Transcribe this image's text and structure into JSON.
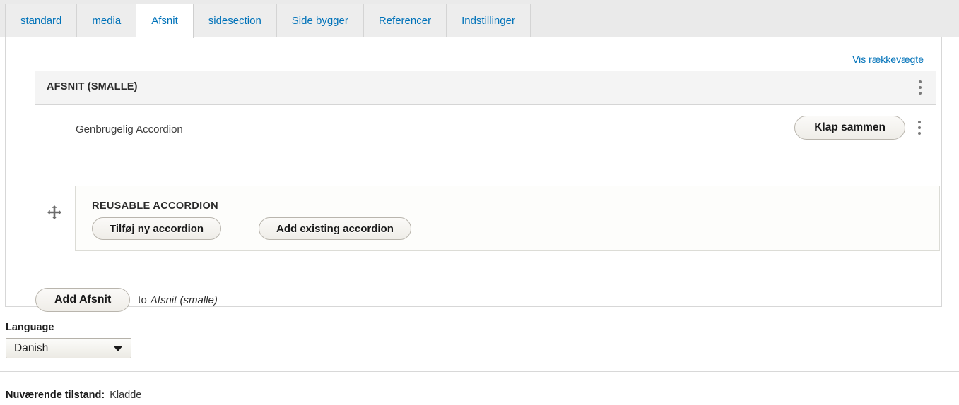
{
  "tabs": [
    {
      "label": "standard",
      "active": false
    },
    {
      "label": "media",
      "active": false
    },
    {
      "label": "Afsnit",
      "active": true
    },
    {
      "label": "sidesection",
      "active": false
    },
    {
      "label": "Side bygger",
      "active": false
    },
    {
      "label": "Referencer",
      "active": false
    },
    {
      "label": "Indstillinger",
      "active": false
    }
  ],
  "panel": {
    "row_weights_link": "Vis rækkevægte",
    "section": {
      "title": "AFSNIT (SMALLE)",
      "menu_icon": "kebab-menu-icon"
    },
    "subrow": {
      "label": "Genbrugelig Accordion",
      "collapse_button": "Klap sammen",
      "menu_icon": "kebab-menu-icon"
    },
    "accordion": {
      "drag_icon": "move-handle-icon",
      "title": "REUSABLE ACCORDION",
      "add_new_button": "Tilføj ny accordion",
      "add_existing_button": "Add existing accordion"
    },
    "add_row": {
      "button": "Add Afsnit",
      "preposition": "to",
      "target": "Afsnit (smalle)"
    }
  },
  "language": {
    "label": "Language",
    "selected": "Danish",
    "options": [
      "Danish"
    ],
    "arrow_icon": "chevron-down-icon"
  },
  "status": {
    "label": "Nuværende tilstand:",
    "value": "Kladde"
  },
  "colors": {
    "link": "#0072b9",
    "tab_inactive_bg": "#ededed",
    "tab_active_bg": "#ffffff",
    "section_header_bg": "#f4f4f4"
  }
}
